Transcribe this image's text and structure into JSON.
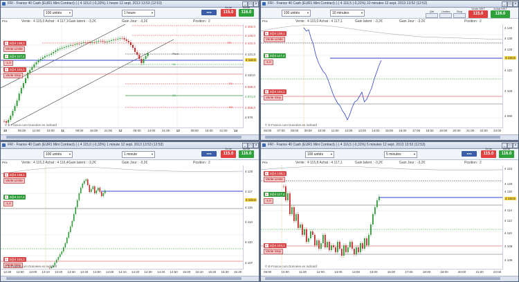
{
  "panes": [
    {
      "id": "tl",
      "title": "FRI - France 40 Cash (EUR1 Mini Contract) (-)   4 115,0 (-0,33%)   1 heure  12 sept. 2013 13:53 (12:53)",
      "qty": "100 unités",
      "timeframe": "1 heure",
      "sell_price": "115.0",
      "buy_price": "116.0",
      "sell_caption": "Vente",
      "buy_caption": "Achat",
      "info_prices": "Vente : 4 115,0 Achat : 4 117,1",
      "info_gain_latent": "Gain latent :   -3,2€",
      "info_gain_jour": "Gain Jour :   -3,2€",
      "info_position": "Position : 2",
      "prev": "Prix",
      "orders": [
        "Vente Limite",
        "Vente Stop"
      ],
      "order_nums": [
        "2@4 138,1",
        "2@4 117,4",
        "2@4 104,1"
      ],
      "order_tags": [
        "-1,0"
      ],
      "y_labels": [
        "4 162,0",
        "4 145,0",
        "4 131,0",
        "4 121,0",
        "4 116,5",
        "4 110,0",
        "4 090,0",
        "4 071,0",
        "4 055,0",
        "4 070"
      ],
      "x_labels": [
        "10",
        "05:00",
        "12:00",
        "19:00",
        "11",
        "09:00",
        "16:00",
        "21:00",
        "12",
        "09:00",
        "14:00",
        "21:00",
        "13",
        "09:00",
        "16:00",
        "21:00",
        "14"
      ],
      "line_labels": [
        "R2",
        "R1",
        "S1",
        "S2",
        "S3",
        "Pivot"
      ],
      "credit": "© E-France.com  Données en indicatif"
    },
    {
      "id": "tr",
      "title": "FRI - France 40 Cash (EUR1 Mini Contract) (-)   4 116,5 (-0,31%)   10 minutes  12 sept. 2013 13:52 (12:52)",
      "qty": "100 unités",
      "timeframe": "10 minutes",
      "sell_price": "115.0",
      "buy_price": "116.0",
      "sell_caption": "Vente MKT",
      "buy_caption": "Achat MKT",
      "mini_labels": [
        "Qté",
        "Limites",
        "Stop"
      ],
      "info_prices": "Vente : 4 115,0 Achat : 4 117,1",
      "info_gain_latent": "Gain latent :   -3,2€",
      "info_gain_jour": "Gain Jour :   -3,2€",
      "info_position": "Position : 2",
      "prev": "Prix",
      "orders": [
        "Vente Limite",
        "Vente Stop"
      ],
      "order_nums": [
        "2@4 138,1",
        "2@4 117,4",
        "2@4 104,1"
      ],
      "order_tags": [
        "-1,0"
      ],
      "y_labels": [
        "4 140",
        "4 130",
        "4 120",
        "4 116,5",
        "4 110",
        "4 100",
        "4 090"
      ],
      "x_labels": [
        "06:00",
        "07:00",
        "08:00",
        "09:00",
        "10:00",
        "11:00",
        "12:00",
        "13:00",
        "14:00",
        "15:00",
        "16:00",
        "17:00",
        "18:00",
        "19:00",
        "20:00",
        "21:00",
        "22:00",
        "23:00"
      ],
      "credit": "© E-France.com  Données en indicatif"
    },
    {
      "id": "bl",
      "title": "FRI - France 40 Cash (EUR1 Mini Contract) (-)   4 115,0 (-0,33%)   1 minute  12 sept. 2013 13:53 (12:53)",
      "qty": "100 unités",
      "timeframe": "1 minute",
      "sell_price": "115.0",
      "buy_price": "116.0",
      "sell_caption": "Vente",
      "buy_caption": "Achat",
      "info_prices": "Vente : 4 115,2 Achat : 4 116,4",
      "info_gain_latent": "Gain latent :   -3,2€",
      "info_gain_jour": "Gain Jour :   -3,2€",
      "info_position": "Position : 2",
      "prev": "Prix",
      "orders": [
        "Vente Limite",
        "Vente Stop"
      ],
      "order_nums": [
        "2@4 138,1",
        "2@4 117,4",
        "2@4 104,1"
      ],
      "order_tags": [
        "-1,0"
      ],
      "y_labels": [
        "4 120",
        "4 117",
        "4 115,8",
        "4 115",
        "4 113",
        "4 110",
        "4 107"
      ],
      "x_labels": [
        "12:40",
        "12:50",
        "13:00",
        "13:10",
        "13:20",
        "13:30",
        "13:40",
        "13:50",
        "14:00",
        "14:10",
        "14:20",
        "14:30",
        "14:40",
        "14:50",
        "15:00",
        "15:10",
        "15:20",
        "15:30",
        "15:40"
      ],
      "credit": "© E-France.com  Données en indicatif"
    },
    {
      "id": "br",
      "title": "FRI - France 40 Cash (EUR1 Mini Contract) (-)   4 116,5 (-0,31%)   5 minutes  12 sept. 2013 13:53 (12:53)",
      "qty": "100 unités",
      "timeframe": "5 minutes",
      "sell_price": "115.0",
      "buy_price": "116.0",
      "sell_caption": "Vente",
      "buy_caption": "Achat",
      "info_prices": "Vente : 4 115,8 Achat : 4 117,1",
      "info_gain_latent": "Gain latent :   -3,2€",
      "info_gain_jour": "Gain Jour :   -3,2€",
      "info_position": "Position : 2",
      "prev": "Prix",
      "orders": [
        "Vente Limite",
        "Vente Stop"
      ],
      "order_nums": [
        "2@4 138,1",
        "2@4 117,4",
        "2@4 104,1"
      ],
      "order_tags": [
        "-1,0"
      ],
      "y_labels": [
        "4 124",
        "4 120",
        "4 118",
        "4 116,5",
        "4 114",
        "4 112",
        "4 110",
        "4 108",
        "4 106"
      ],
      "x_labels": [
        "09:00",
        "10:00",
        "11:00",
        "12:00",
        "13:00",
        "14:00",
        "15:00",
        "16:00",
        "17:00",
        "18:00",
        "19:00",
        "20:00",
        "21:00",
        "22:00"
      ],
      "credit": "© E-France.com  Données en indicatif"
    }
  ],
  "colors": {
    "up": "#2e9b36",
    "down": "#c42a2a",
    "blue": "#2f3fd6",
    "sell": "#e04040",
    "buy": "#2ea23a"
  }
}
